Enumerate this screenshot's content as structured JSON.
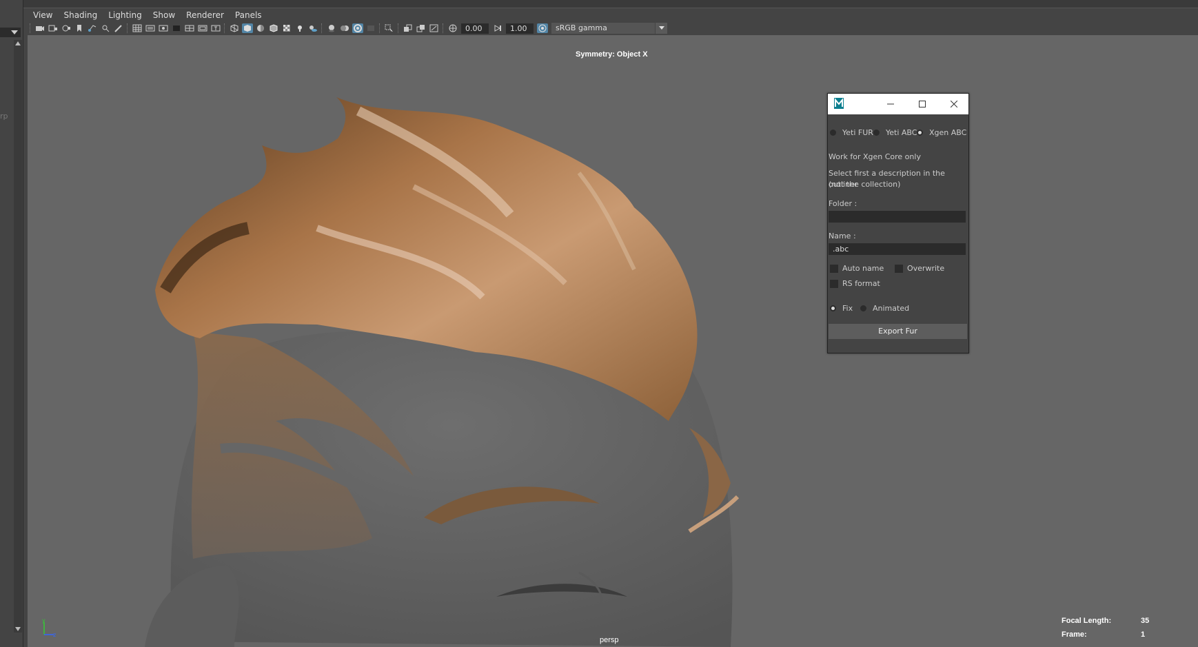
{
  "menu": [
    "View",
    "Shading",
    "Lighting",
    "Show",
    "Renderer",
    "Panels"
  ],
  "toolbar": {
    "exposure": "0.00",
    "gamma": "1.00",
    "color_space": "sRGB gamma"
  },
  "left_strip": {
    "partial_text": "rp"
  },
  "viewport": {
    "symmetry": "Symmetry: Object X",
    "camera": "persp",
    "hud": [
      {
        "label": "Focal Length:",
        "value": "35"
      },
      {
        "label": "Frame:",
        "value": "1"
      }
    ],
    "axis": {
      "y": "y",
      "z": "z"
    }
  },
  "dialog": {
    "logo": "M",
    "radios": [
      {
        "label": "Yeti FUR",
        "checked": false
      },
      {
        "label": "Yeti ABC",
        "checked": false
      },
      {
        "label": "Xgen ABC",
        "checked": true
      }
    ],
    "note1": "Work for Xgen Core only",
    "note2a": "Select first a description in the outliner",
    "note2b": "(not the collection)",
    "folder_label": "Folder :",
    "folder_value": "",
    "name_label": "Name :",
    "name_value": ".abc",
    "checkboxes": [
      {
        "label": "Auto name",
        "checked": false
      },
      {
        "label": "Overwrite",
        "checked": false
      },
      {
        "label": "RS format",
        "checked": false
      }
    ],
    "mode": [
      {
        "label": "Fix",
        "checked": true
      },
      {
        "label": "Animated",
        "checked": false
      }
    ],
    "export_label": "Export Fur"
  }
}
